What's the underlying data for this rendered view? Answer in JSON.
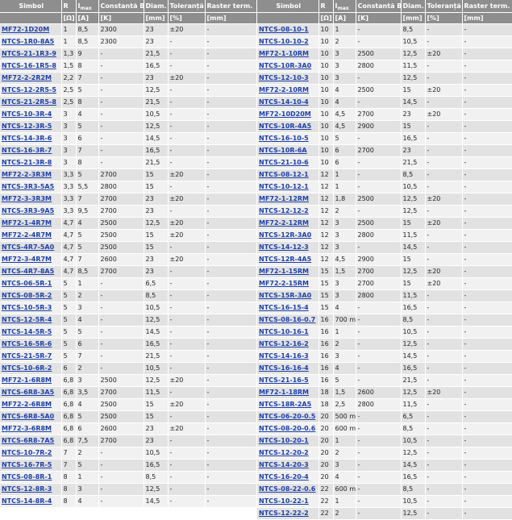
{
  "headers": {
    "symbol": "Simbol",
    "r": "R",
    "imax": "I",
    "imax_sub": "max",
    "beta": "Constantă B",
    "diam": "Diam.",
    "tol": "Toleranță",
    "pitch": "Raster term.",
    "u_r": "[Ω]",
    "u_i": "[A]",
    "u_b": "[K]",
    "u_d": "[mm]",
    "u_t": "[%]",
    "u_p": "[mm]"
  },
  "left_rows": [
    [
      "MF72-1D20M",
      "1",
      "8,5",
      "2300",
      "23",
      "±20",
      "-"
    ],
    [
      "NTCS-1R0-8A5",
      "1",
      "8,5",
      "2300",
      "23",
      "-",
      "-"
    ],
    [
      "NTCS-21-1R3-9",
      "1,3",
      "9",
      "-",
      "21,5",
      "-",
      "-"
    ],
    [
      "NTCS-16-1R5-8",
      "1,5",
      "8",
      "-",
      "16,5",
      "-",
      "-"
    ],
    [
      "MF72-2-2R2M",
      "2,2",
      "7",
      "-",
      "23",
      "±20",
      "-"
    ],
    [
      "NTCS-12-2R5-5",
      "2,5",
      "5",
      "-",
      "12,5",
      "-",
      "-"
    ],
    [
      "NTCS-21-2R5-8",
      "2,5",
      "8",
      "-",
      "21,5",
      "-",
      "-"
    ],
    [
      "NTCS-10-3R-4",
      "3",
      "4",
      "-",
      "10,5",
      "-",
      "-"
    ],
    [
      "NTCS-12-3R-5",
      "3",
      "5",
      "-",
      "12,5",
      "-",
      "-"
    ],
    [
      "NTCS-14-3R-6",
      "3",
      "6",
      "-",
      "14,5",
      "-",
      "-"
    ],
    [
      "NTCS-16-3R-7",
      "3",
      "7",
      "-",
      "16,5",
      "-",
      "-"
    ],
    [
      "NTCS-21-3R-8",
      "3",
      "8",
      "-",
      "21,5",
      "-",
      "-"
    ],
    [
      "MF72-2-3R3M",
      "3,3",
      "5",
      "2700",
      "15",
      "±20",
      "-"
    ],
    [
      "NTCS-3R3-5A5",
      "3,3",
      "5,5",
      "2800",
      "15",
      "-",
      "-"
    ],
    [
      "MF72-3-3R3M",
      "3,3",
      "7",
      "2700",
      "23",
      "±20",
      "-"
    ],
    [
      "NTCS-3R3-9A5",
      "3,3",
      "9,5",
      "2700",
      "23",
      "-",
      "-"
    ],
    [
      "MF72-1-4R7M",
      "4,7",
      "4",
      "2500",
      "12,5",
      "±20",
      "-"
    ],
    [
      "MF72-2-4R7M",
      "4,7",
      "5",
      "2500",
      "15",
      "±20",
      "-"
    ],
    [
      "NTCS-4R7-5A0",
      "4,7",
      "5",
      "2500",
      "15",
      "-",
      "-"
    ],
    [
      "MF72-3-4R7M",
      "4,7",
      "7",
      "2600",
      "23",
      "±20",
      "-"
    ],
    [
      "NTCS-4R7-8A5",
      "4,7",
      "8,5",
      "2700",
      "23",
      "-",
      "-"
    ],
    [
      "NTCS-06-5R-1",
      "5",
      "1",
      "-",
      "6,5",
      "-",
      "-"
    ],
    [
      "NTCS-08-5R-2",
      "5",
      "2",
      "-",
      "8,5",
      "-",
      "-"
    ],
    [
      "NTCS-10-5R-3",
      "5",
      "3",
      "-",
      "10,5",
      "-",
      "-"
    ],
    [
      "NTCS-12-5R-4",
      "5",
      "4",
      "-",
      "12,5",
      "-",
      "-"
    ],
    [
      "NTCS-14-5R-5",
      "5",
      "5",
      "-",
      "14,5",
      "-",
      "-"
    ],
    [
      "NTCS-16-5R-6",
      "5",
      "6",
      "-",
      "16,5",
      "-",
      "-"
    ],
    [
      "NTCS-21-5R-7",
      "5",
      "7",
      "-",
      "21,5",
      "-",
      "-"
    ],
    [
      "NTCS-10-6R-2",
      "6",
      "2",
      "-",
      "10,5",
      "-",
      "-"
    ],
    [
      "MF72-1-6R8M",
      "6,8",
      "3",
      "2500",
      "12,5",
      "±20",
      "-"
    ],
    [
      "NTCS-6R8-3A5",
      "6,8",
      "3,5",
      "2700",
      "11,5",
      "-",
      "-"
    ],
    [
      "MF72-2-6R8M",
      "6,8",
      "4",
      "2500",
      "15",
      "±20",
      "-"
    ],
    [
      "NTCS-6R8-5A0",
      "6,8",
      "5",
      "2500",
      "15",
      "-",
      "-"
    ],
    [
      "MF72-3-6R8M",
      "6,8",
      "6",
      "2600",
      "23",
      "±20",
      "-"
    ],
    [
      "NTCS-6R8-7A5",
      "6,8",
      "7,5",
      "2700",
      "23",
      "-",
      "-"
    ],
    [
      "NTCS-10-7R-2",
      "7",
      "2",
      "-",
      "10,5",
      "-",
      "-"
    ],
    [
      "NTCS-16-7R-5",
      "7",
      "5",
      "-",
      "16,5",
      "-",
      "-"
    ],
    [
      "NTCS-08-8R-1",
      "8",
      "1",
      "-",
      "8,5",
      "-",
      "-"
    ],
    [
      "NTCS-12-8R-3",
      "8",
      "3",
      "-",
      "12,5",
      "-",
      "-"
    ],
    [
      "NTCS-14-8R-4",
      "8",
      "4",
      "-",
      "14,5",
      "-",
      "-"
    ]
  ],
  "right_rows": [
    [
      "NTCS-08-10-1",
      "10",
      "1",
      "-",
      "8,5",
      "-",
      "-"
    ],
    [
      "NTCS-10-10-2",
      "10",
      "2",
      "-",
      "10,5",
      "-",
      "-"
    ],
    [
      "MF72-1-10RM",
      "10",
      "3",
      "2500",
      "12,5",
      "±20",
      "-"
    ],
    [
      "NTCS-10R-3A0",
      "10",
      "3",
      "2800",
      "11,5",
      "-",
      "-"
    ],
    [
      "NTCS-12-10-3",
      "10",
      "3",
      "-",
      "12,5",
      "-",
      "-"
    ],
    [
      "MF72-2-10RM",
      "10",
      "4",
      "2500",
      "15",
      "±20",
      "-"
    ],
    [
      "NTCS-14-10-4",
      "10",
      "4",
      "-",
      "14,5",
      "-",
      "-"
    ],
    [
      "MF72-10D20M",
      "10",
      "4,5",
      "2700",
      "23",
      "±20",
      "-"
    ],
    [
      "NTCS-10R-4A5",
      "10",
      "4,5",
      "2900",
      "15",
      "-",
      "-"
    ],
    [
      "NTCS-16-10-5",
      "10",
      "5",
      "-",
      "16,5",
      "-",
      "-"
    ],
    [
      "NTCS-10R-6A",
      "10",
      "6",
      "2700",
      "23",
      "-",
      "-"
    ],
    [
      "NTCS-21-10-6",
      "10",
      "6",
      "-",
      "21,5",
      "-",
      "-"
    ],
    [
      "NTCS-08-12-1",
      "12",
      "1",
      "-",
      "8,5",
      "-",
      "-"
    ],
    [
      "NTCS-10-12-1",
      "12",
      "1",
      "-",
      "10,5",
      "-",
      "-"
    ],
    [
      "MF72-1-12RM",
      "12",
      "1,8",
      "2500",
      "12,5",
      "±20",
      "-"
    ],
    [
      "NTCS-12-12-2",
      "12",
      "2",
      "-",
      "12,5",
      "-",
      "-"
    ],
    [
      "MF72-2-12RM",
      "12",
      "3",
      "2500",
      "15",
      "±20",
      "-"
    ],
    [
      "NTCS-12R-3A0",
      "12",
      "3",
      "2800",
      "11,5",
      "-",
      "-"
    ],
    [
      "NTCS-14-12-3",
      "12",
      "3",
      "-",
      "14,5",
      "-",
      "-"
    ],
    [
      "NTCS-12R-4A5",
      "12",
      "4,5",
      "2900",
      "15",
      "-",
      "-"
    ],
    [
      "MF72-1-15RM",
      "15",
      "1,5",
      "2700",
      "12,5",
      "±20",
      "-"
    ],
    [
      "MF72-2-15RM",
      "15",
      "3",
      "2700",
      "15",
      "±20",
      "-"
    ],
    [
      "NTCS-15R-3A0",
      "15",
      "3",
      "2800",
      "11,5",
      "-",
      "-"
    ],
    [
      "NTCS-16-15-4",
      "15",
      "4",
      "-",
      "16,5",
      "-",
      "-"
    ],
    [
      "NTCS-08-16-0.7",
      "16",
      "700 m",
      "-",
      "8,5",
      "-",
      "-"
    ],
    [
      "NTCS-10-16-1",
      "16",
      "1",
      "-",
      "10,5",
      "-",
      "-"
    ],
    [
      "NTCS-12-16-2",
      "16",
      "2",
      "-",
      "12,5",
      "-",
      "-"
    ],
    [
      "NTCS-14-16-3",
      "16",
      "3",
      "-",
      "14,5",
      "-",
      "-"
    ],
    [
      "NTCS-16-16-4",
      "16",
      "4",
      "-",
      "16,5",
      "-",
      "-"
    ],
    [
      "NTCS-21-16-5",
      "16",
      "5",
      "-",
      "21,5",
      "-",
      "-"
    ],
    [
      "MF72-1-18RM",
      "18",
      "1,5",
      "2600",
      "12,5",
      "±20",
      "-"
    ],
    [
      "NTCS-18R-2A5",
      "18",
      "2,5",
      "2800",
      "11,5",
      "-",
      "-"
    ],
    [
      "NTCS-06-20-0.5",
      "20",
      "500 m",
      "-",
      "6,5",
      "-",
      "-"
    ],
    [
      "NTCS-08-20-0.6",
      "20",
      "600 m",
      "-",
      "8,5",
      "-",
      "-"
    ],
    [
      "NTCS-10-20-1",
      "20",
      "1",
      "-",
      "10,5",
      "-",
      "-"
    ],
    [
      "NTCS-12-20-2",
      "20",
      "2",
      "-",
      "12,5",
      "-",
      "-"
    ],
    [
      "NTCS-14-20-3",
      "20",
      "3",
      "-",
      "14,5",
      "-",
      "-"
    ],
    [
      "NTCS-16-20-4",
      "20",
      "4",
      "-",
      "16,5",
      "-",
      "-"
    ],
    [
      "NTCS-08-22-0.6",
      "22",
      "600 m",
      "-",
      "8,5",
      "-",
      "-"
    ],
    [
      "NTCS-10-22-1",
      "22",
      "1",
      "-",
      "10,5",
      "-",
      "-"
    ],
    [
      "NTCS-12-22-2",
      "22",
      "2",
      "-",
      "12,5",
      "-",
      "-"
    ]
  ]
}
